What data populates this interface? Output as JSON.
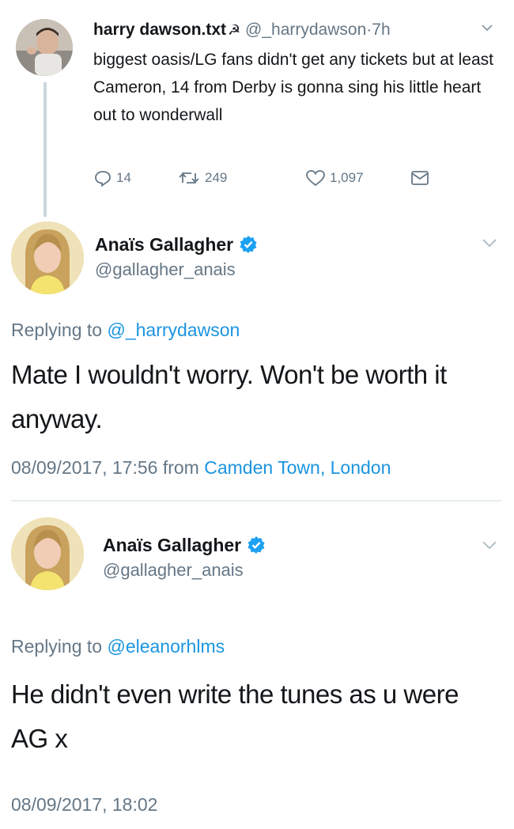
{
  "tweet1": {
    "name": "harry dawson.txt",
    "name_emoji": "☭",
    "handle": "@_harrydawson",
    "separator": "·",
    "time": "7h",
    "text": "biggest oasis/LG fans didn't get any tickets but at least Cameron, 14 from Derby is gonna sing his little heart out to wonderwall",
    "replies": "14",
    "retweets": "249",
    "likes": "1,097"
  },
  "reply1": {
    "name": "Anaïs Gallagher",
    "handle": "@gallagher_anais",
    "replying_prefix": "Replying to",
    "replying_to": "@_harrydawson",
    "text": "Mate I wouldn't worry. Won't be worth it anyway.",
    "timestamp": "08/09/2017, 17:56",
    "from_prefix": "from",
    "location": "Camden Town, London"
  },
  "reply2": {
    "name": "Anaïs Gallagher",
    "handle": "@gallagher_anais",
    "replying_prefix": "Replying to",
    "replying_to": "@eleanorhlms",
    "text": "He didn't even write the tunes as u were AG x",
    "timestamp": "08/09/2017, 18:02"
  },
  "colors": {
    "link": "#1b95e0",
    "verified": "#1da1f2",
    "muted": "#657786",
    "text": "#14171a"
  },
  "icons": {
    "reply": "reply-icon",
    "retweet": "retweet-icon",
    "like": "heart-icon",
    "message": "envelope-icon",
    "verified": "verified-badge-icon",
    "chevron": "chevron-down-icon"
  }
}
